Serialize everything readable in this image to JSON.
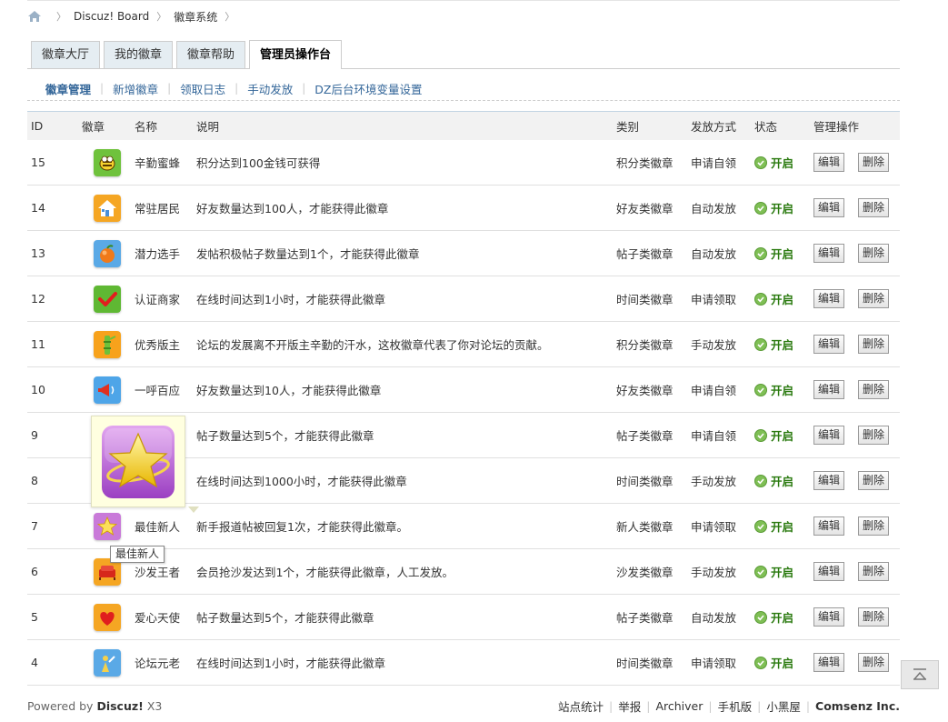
{
  "breadcrumb": {
    "home": "home",
    "board": "Discuz! Board",
    "section": "徽章系统"
  },
  "tabs": [
    "徽章大厅",
    "我的徽章",
    "徽章帮助",
    "管理员操作台"
  ],
  "subnav": [
    "徽章管理",
    "新增徽章",
    "领取日志",
    "手动发放",
    "DZ后台环境变量设置"
  ],
  "table": {
    "headers": [
      "ID",
      "徽章",
      "名称",
      "说明",
      "类别",
      "发放方式",
      "状态",
      "管理操作"
    ],
    "state_label": "开启",
    "edit_label": "编辑",
    "delete_label": "删除",
    "rows": [
      {
        "id": "15",
        "name": "辛勤蜜蜂",
        "desc": "积分达到100金钱可获得",
        "type": "积分类徽章",
        "mode": "申请自领",
        "icon": "bee-icon"
      },
      {
        "id": "14",
        "name": "常驻居民",
        "desc": "好友数量达到100人，才能获得此徽章",
        "type": "好友类徽章",
        "mode": "自动发放",
        "icon": "house-icon"
      },
      {
        "id": "13",
        "name": "潜力选手",
        "desc": "发帖积极帖子数量达到1个，才能获得此徽章",
        "type": "帖子类徽章",
        "mode": "自动发放",
        "icon": "fruit-icon"
      },
      {
        "id": "12",
        "name": "认证商家",
        "desc": "在线时间达到1小时，才能获得此徽章",
        "type": "时间类徽章",
        "mode": "申请领取",
        "icon": "check-icon"
      },
      {
        "id": "11",
        "name": "优秀版主",
        "desc": "论坛的发展离不开版主辛勤的汗水，这枚徽章代表了你对论坛的贡献。",
        "type": "积分类徽章",
        "mode": "手动发放",
        "icon": "bamboo-icon"
      },
      {
        "id": "10",
        "name": "一呼百应",
        "desc": "好友数量达到10人，才能获得此徽章",
        "type": "好友类徽章",
        "mode": "申请自领",
        "icon": "megaphone-icon"
      },
      {
        "id": "9",
        "name": "",
        "desc": "帖子数量达到5个，才能获得此徽章",
        "type": "帖子类徽章",
        "mode": "申请自领",
        "icon": ""
      },
      {
        "id": "8",
        "name": "",
        "desc": "在线时间达到1000小时，才能获得此徽章",
        "type": "时间类徽章",
        "mode": "手动发放",
        "icon": ""
      },
      {
        "id": "7",
        "name": "最佳新人",
        "desc": "新手报道帖被回复1次，才能获得此徽章。",
        "type": "新人类徽章",
        "mode": "申请领取",
        "icon": "star-icon"
      },
      {
        "id": "6",
        "name": "沙发王者",
        "desc": "会员抢沙发达到1个，才能获得此徽章，人工发放。",
        "type": "沙发类徽章",
        "mode": "手动发放",
        "icon": "sofa-icon"
      },
      {
        "id": "5",
        "name": "爱心天使",
        "desc": "帖子数量达到5个，才能获得此徽章",
        "type": "帖子类徽章",
        "mode": "自动发放",
        "icon": "heart-icon"
      },
      {
        "id": "4",
        "name": "论坛元老",
        "desc": "在线时间达到1小时，才能获得此徽章",
        "type": "时间类徽章",
        "mode": "申请领取",
        "icon": "veteran-icon"
      }
    ]
  },
  "tooltip": "最佳新人",
  "footer": {
    "powered_prefix": "Powered by",
    "powered_brand": "Discuz!",
    "powered_version": "X3",
    "links": [
      "站点统计",
      "举报",
      "Archiver",
      "手机版",
      "小黑屋"
    ],
    "company": "Comsenz Inc."
  },
  "colors": {
    "link": "#336699",
    "on": "#2a7a0f",
    "tab_bg": "#e5edf2"
  }
}
